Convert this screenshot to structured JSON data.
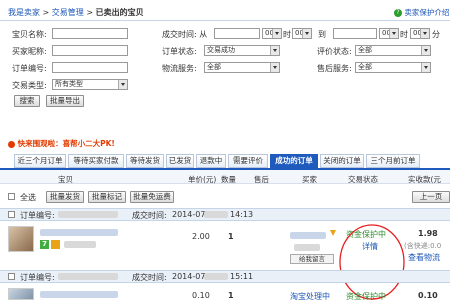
{
  "breadcrumb": {
    "home": "我是卖家",
    "sep1": ">",
    "section": "交易管理",
    "sep2": ">",
    "current": "已卖出的宝贝"
  },
  "help": {
    "label": "卖家保护介绍",
    "icon": "help-icon"
  },
  "form": {
    "baby_name_label": "宝贝名称:",
    "buyer_nick_label": "买家昵称:",
    "order_no_label": "订单编号:",
    "trade_type_label": "交易类型:",
    "trade_type_value": "所有类型",
    "deal_time_label": "成交时间: 从",
    "to_label": "到",
    "hour_unit": "时",
    "minute_unit": "分",
    "hour_value": "00",
    "minute_value": "00",
    "order_status_label": "订单状态:",
    "order_status_value": "交易成功",
    "logistics_label": "物流服务:",
    "logistics_value": "全部",
    "review_label": "评价状态:",
    "review_value": "全部",
    "aftersale_label": "售后服务:",
    "aftersale_value": "全部",
    "search_button": "搜索",
    "export_button": "批量导出"
  },
  "promo": {
    "text1": "快来围观啦：喜帮小二大PK!"
  },
  "tabs": [
    "近三个月订单",
    "等待买家付款",
    "等待发货",
    "已发货",
    "退款中",
    "需要评价",
    "成功的订单",
    "关闭的订单",
    "三个月前订单"
  ],
  "active_tab_index": 6,
  "table_headers": {
    "baby": "宝贝",
    "price": "单价(元)",
    "qty": "数量",
    "aftersale": "售后",
    "buyer": "买家",
    "status": "交易状态",
    "paid": "实收款(元"
  },
  "bulk": {
    "select_all": "全选",
    "ship": "批量发货",
    "mark": "批量标记",
    "free_ship": "批量免运费"
  },
  "pagination": {
    "prev": "上一页"
  },
  "orders": [
    {
      "order_label": "订单编号:",
      "deal_time_label": "成交时间:",
      "deal_time": "2014-07",
      "deal_time_suffix": "14:13",
      "price": "2.00",
      "qty": "1",
      "status": "资金保护中",
      "status_detail": "详情",
      "paid": "1.98",
      "paid_note": "(含快递:0.0",
      "paid_link": "查看物流",
      "message_label": "给我留言",
      "badge": "7"
    },
    {
      "order_label": "订单编号:",
      "deal_time_label": "成交时间:",
      "deal_time": "2014-07",
      "deal_time_suffix": "15:11",
      "price": "0.10",
      "qty": "1",
      "buyer": "淘宝处理中",
      "status": "资金保护中",
      "paid": "0.10"
    }
  ],
  "colors": {
    "accent": "#1f5bbd",
    "link": "#1a56b8",
    "promo": "#e23a00",
    "annotation": "#e52020"
  }
}
